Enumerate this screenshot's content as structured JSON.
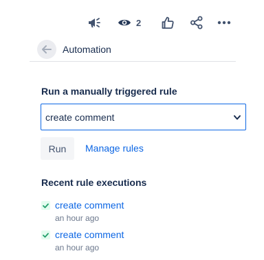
{
  "toolbar": {
    "watch_count": "2"
  },
  "panel": {
    "title": "Automation"
  },
  "manual": {
    "heading": "Run a manually triggered rule",
    "selected_rule": "create comment",
    "run_label": "Run",
    "manage_label": "Manage rules"
  },
  "recent": {
    "heading": "Recent rule executions",
    "items": [
      {
        "name": "create comment",
        "time": "an hour ago",
        "status": "success"
      },
      {
        "name": "create comment",
        "time": "an hour ago",
        "status": "success"
      }
    ]
  },
  "colors": {
    "link": "#0c66e4",
    "success": "#22a06b",
    "text": "#172b4d"
  }
}
